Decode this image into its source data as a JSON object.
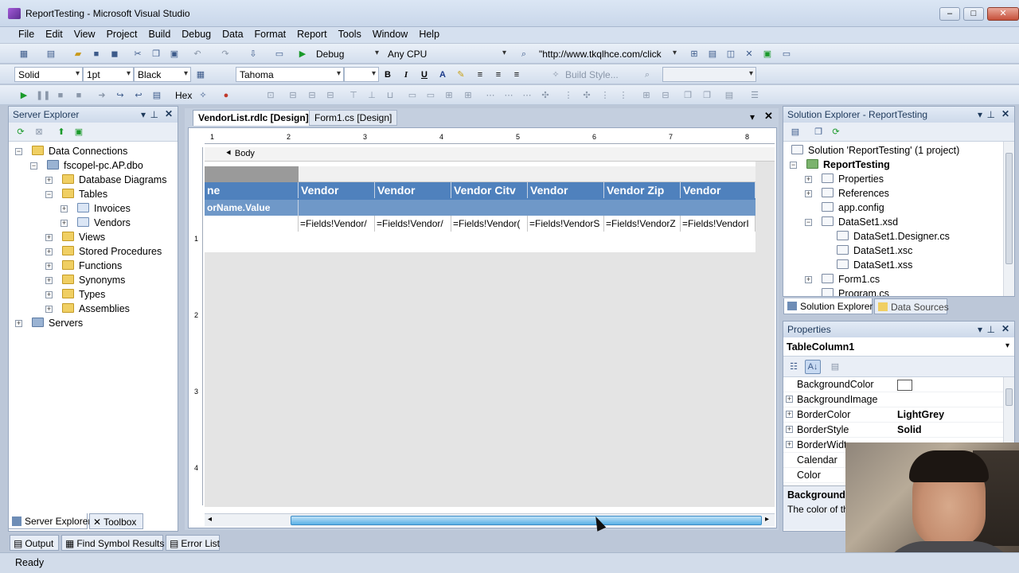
{
  "window": {
    "title": "ReportTesting - Microsoft Visual Studio"
  },
  "menu": [
    "File",
    "Edit",
    "View",
    "Project",
    "Build",
    "Debug",
    "Data",
    "Format",
    "Report",
    "Tools",
    "Window",
    "Help"
  ],
  "toolbar1": {
    "config": "Debug",
    "platform": "Any CPU",
    "url": "\"http://www.tkqlhce.com/click"
  },
  "toolbar2": {
    "border_style": "Solid",
    "border_width": "1pt",
    "border_color": "Black",
    "font": "Tahoma",
    "bold": "B",
    "italic": "I",
    "underline": "U",
    "build_style": "Build Style..."
  },
  "toolbar3": {
    "hex": "Hex"
  },
  "server_explorer": {
    "title": "Server Explorer",
    "items": [
      {
        "label": "Data Connections"
      },
      {
        "label": "fscopel-pc.AP.dbo"
      },
      {
        "label": "Database Diagrams"
      },
      {
        "label": "Tables"
      },
      {
        "label": "Invoices"
      },
      {
        "label": "Vendors"
      },
      {
        "label": "Views"
      },
      {
        "label": "Stored Procedures"
      },
      {
        "label": "Functions"
      },
      {
        "label": "Synonyms"
      },
      {
        "label": "Types"
      },
      {
        "label": "Assemblies"
      },
      {
        "label": "Servers"
      }
    ],
    "tabs": [
      "Server Explorer",
      "Toolbox"
    ]
  },
  "document": {
    "tabs": [
      "VendorList.rdlc [Design]*",
      "Form1.cs [Design]"
    ],
    "ruler_numbers": [
      "1",
      "2",
      "3",
      "4",
      "5",
      "6",
      "7",
      "8"
    ],
    "vruler_numbers": [
      "1",
      "2",
      "3",
      "4"
    ],
    "body_label": "Body",
    "header_cells": [
      "ne",
      "Vendor",
      "Vendor",
      "Vendor Citv",
      "Vendor",
      "Vendor Zip",
      "Vendor"
    ],
    "group_cell": "orName.Value",
    "field_cells": [
      "=Fields!Vendor/",
      "=Fields!Vendor/",
      "=Fields!Vendor(",
      "=Fields!VendorS",
      "=Fields!VendorZ",
      "=Fields!VendorI"
    ]
  },
  "solution_explorer": {
    "title": "Solution Explorer - ReportTesting",
    "items": [
      {
        "label": "Solution 'ReportTesting' (1 project)"
      },
      {
        "label": "ReportTesting"
      },
      {
        "label": "Properties"
      },
      {
        "label": "References"
      },
      {
        "label": "app.config"
      },
      {
        "label": "DataSet1.xsd"
      },
      {
        "label": "DataSet1.Designer.cs"
      },
      {
        "label": "DataSet1.xsc"
      },
      {
        "label": "DataSet1.xss"
      },
      {
        "label": "Form1.cs"
      },
      {
        "label": "Program.cs"
      }
    ],
    "tabs": [
      "Solution Explorer",
      "Data Sources"
    ]
  },
  "properties": {
    "title": "Properties",
    "object": "TableColumn1",
    "rows": [
      {
        "name": "BackgroundColor",
        "value": ""
      },
      {
        "name": "BackgroundImage",
        "value": ""
      },
      {
        "name": "BorderColor",
        "value": "LightGrey"
      },
      {
        "name": "BorderStyle",
        "value": "Solid"
      },
      {
        "name": "BorderWidt",
        "value": ""
      },
      {
        "name": "Calendar",
        "value": ""
      },
      {
        "name": "Color",
        "value": ""
      }
    ],
    "desc_title": "BackgroundC",
    "desc_text": "The color of th"
  },
  "bottom_tabs": [
    "Output",
    "Find Symbol Results",
    "Error List"
  ],
  "status": {
    "text": "Ready"
  },
  "colors": {
    "report_header": "#4f81bd",
    "report_group": "#6f98c8",
    "chrome": "#d5e0ef"
  }
}
